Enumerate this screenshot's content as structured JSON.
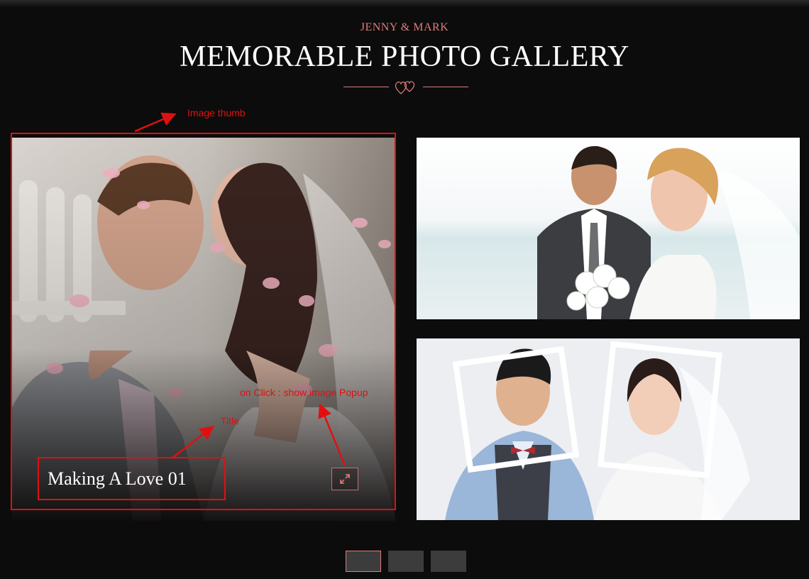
{
  "header": {
    "subtitle": "JENNY & MARK",
    "title": "MEMORABLE PHOTO GALLERY"
  },
  "gallery": {
    "items": [
      {
        "title": "Making A Love 01",
        "photo": "couple-kissing-petals"
      },
      {
        "photo": "couple-beach-smiling"
      },
      {
        "photo": "couple-photo-frames"
      }
    ]
  },
  "annotations": {
    "image_thumb": "Image thumb",
    "on_click": "on Click : show image Popup",
    "title_label": "Title"
  },
  "pager": {
    "count": 3,
    "active_index": 0
  },
  "colors": {
    "accent": "#e27c7c",
    "background": "#0c0c0c",
    "annotation": "#e01010"
  }
}
